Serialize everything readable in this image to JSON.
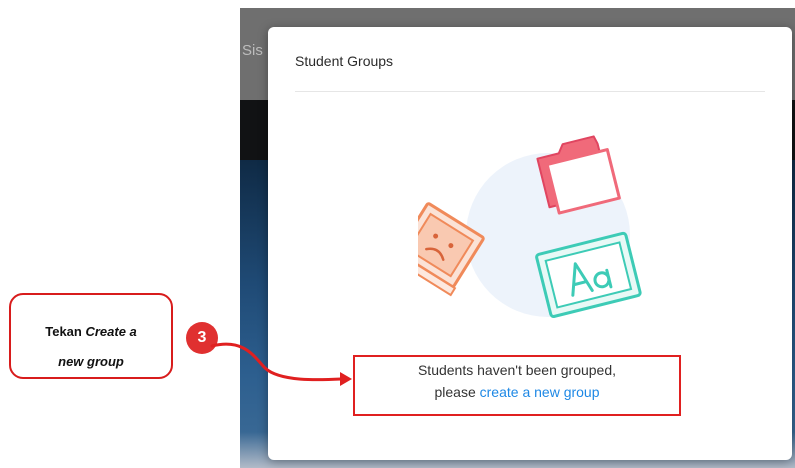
{
  "background_app": {
    "partial_title": "Sis"
  },
  "modal": {
    "title": "Student Groups",
    "empty_message_line1": "Students haven't been grouped,",
    "empty_message_prefix": "please ",
    "create_link": "create a new group",
    "illustration_icons": [
      "sad-computer-icon",
      "folder-icon",
      "font-aa-icon"
    ]
  },
  "annotation": {
    "callout_text_prefix": "Tekan ",
    "callout_text_emphasis_1": "Create a",
    "callout_text_emphasis_2": "new group",
    "step_number": "3",
    "accent_color": "#e02020"
  }
}
